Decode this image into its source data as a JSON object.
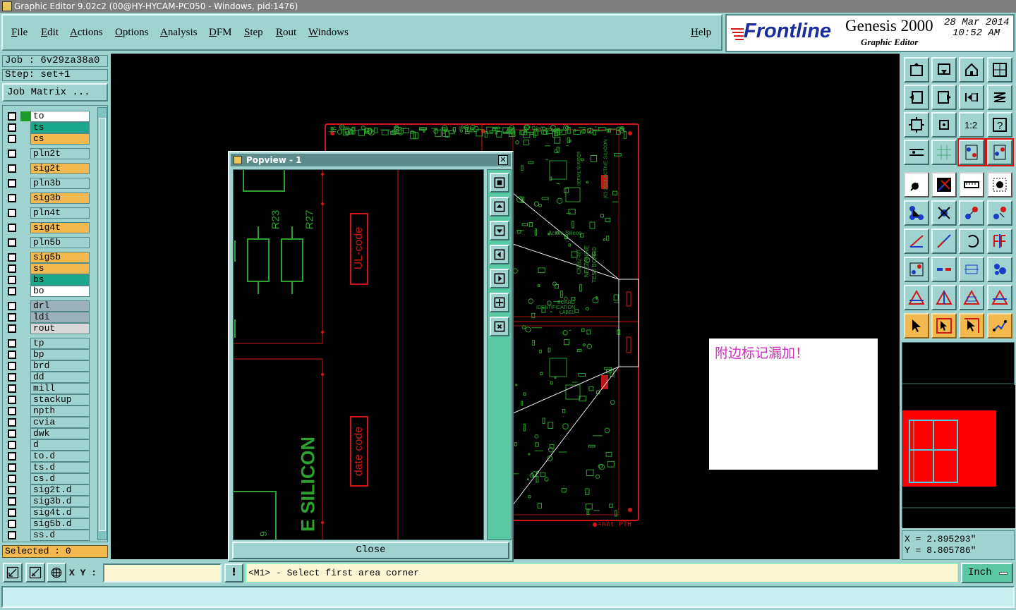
{
  "window": {
    "title": "Graphic Editor 9.02c2 (00@HY-HYCAM-PC050 - Windows, pid:1476)"
  },
  "menu": {
    "file": "File",
    "edit": "Edit",
    "actions": "Actions",
    "options": "Options",
    "analysis": "Analysis",
    "dfm": "DFM",
    "step": "Step",
    "rout": "Rout",
    "windows": "Windows",
    "help": "Help"
  },
  "branding": {
    "logo": "Frontline",
    "product": "Genesis 2000",
    "subtitle": "Graphic Editor",
    "date": "28 Mar 2014",
    "time": "10:52 AM"
  },
  "job": {
    "job_line": "Job : 6v29za38a0",
    "step_line": "Step: set+1",
    "matrix_button": "Job Matrix ..."
  },
  "layers": [
    {
      "name": "to",
      "color": "#ffffff",
      "mark": "#1a9a2a"
    },
    {
      "name": "ts",
      "color": "#19a98a"
    },
    {
      "name": "cs",
      "color": "#f3b94f"
    },
    {
      "name": "pln2t",
      "color": "#9ed3d0"
    },
    {
      "name": "sig2t",
      "color": "#f3b94f"
    },
    {
      "name": "pln3b",
      "color": "#9ed3d0"
    },
    {
      "name": "sig3b",
      "color": "#f3b94f"
    },
    {
      "name": "pln4t",
      "color": "#9ed3d0"
    },
    {
      "name": "sig4t",
      "color": "#f3b94f"
    },
    {
      "name": "pln5b",
      "color": "#9ed3d0"
    },
    {
      "name": "sig5b",
      "color": "#f3b94f"
    },
    {
      "name": "ss",
      "color": "#f3b94f"
    },
    {
      "name": "bs",
      "color": "#19a98a"
    },
    {
      "name": "bo",
      "color": "#ffffff"
    },
    {
      "name": "drl",
      "color": "#9bb0b8"
    },
    {
      "name": "ldi",
      "color": "#9bb0b8"
    },
    {
      "name": "rout",
      "color": "#d8d8d8"
    },
    {
      "name": "tp",
      "color": "#9ed3d0"
    },
    {
      "name": "bp",
      "color": "#9ed3d0"
    },
    {
      "name": "brd",
      "color": "#9ed3d0"
    },
    {
      "name": "dd",
      "color": "#9ed3d0"
    },
    {
      "name": "mill",
      "color": "#9ed3d0"
    },
    {
      "name": "stackup",
      "color": "#9ed3d0"
    },
    {
      "name": "npth",
      "color": "#9ed3d0"
    },
    {
      "name": "cvia",
      "color": "#9ed3d0"
    },
    {
      "name": "dwk",
      "color": "#9ed3d0"
    },
    {
      "name": "d",
      "color": "#9ed3d0"
    },
    {
      "name": "to.d",
      "color": "#9ed3d0"
    },
    {
      "name": "ts.d",
      "color": "#9ed3d0"
    },
    {
      "name": "cs.d",
      "color": "#9ed3d0"
    },
    {
      "name": "sig2t.d",
      "color": "#9ed3d0"
    },
    {
      "name": "sig3b.d",
      "color": "#9ed3d0"
    },
    {
      "name": "sig4t.d",
      "color": "#9ed3d0"
    },
    {
      "name": "sig5b.d",
      "color": "#9ed3d0"
    },
    {
      "name": "ss.d",
      "color": "#9ed3d0"
    }
  ],
  "selected": "Selected : 0",
  "popview": {
    "title": "Popview - 1",
    "close": "Close",
    "labels": {
      "r23": "R23",
      "r27": "R27",
      "ul": "UL-code",
      "date": "date code",
      "silicon": "E SILICON",
      "nine": "9"
    }
  },
  "board": {
    "legend": "=not PTH",
    "silk": [
      "Active Silicon",
      "CMBZ-RT",
      "NEZZANINE",
      "TEST BOARD",
      "BOARD",
      "IDENTIFICATION",
      "LABEL",
      "(C) 2014 ACTIVE SILICON",
      "SERIAL NUMBER"
    ]
  },
  "note": {
    "text": "附边标记漏加！"
  },
  "coords": {
    "x": "X = 2.895293\"",
    "y": "Y = 8.805786\""
  },
  "bottom": {
    "xy_label": "X Y :",
    "xy_value": "",
    "bang": "!",
    "prompt": "<M1> - Select first area corner",
    "units": "Inch"
  },
  "colors": {
    "canvas": "#000000",
    "board_outline": "#d01818",
    "copper": "#2ea02e",
    "accent": "#9ed3d0",
    "orange": "#f3b94f",
    "note_text": "#cc2fbf"
  }
}
